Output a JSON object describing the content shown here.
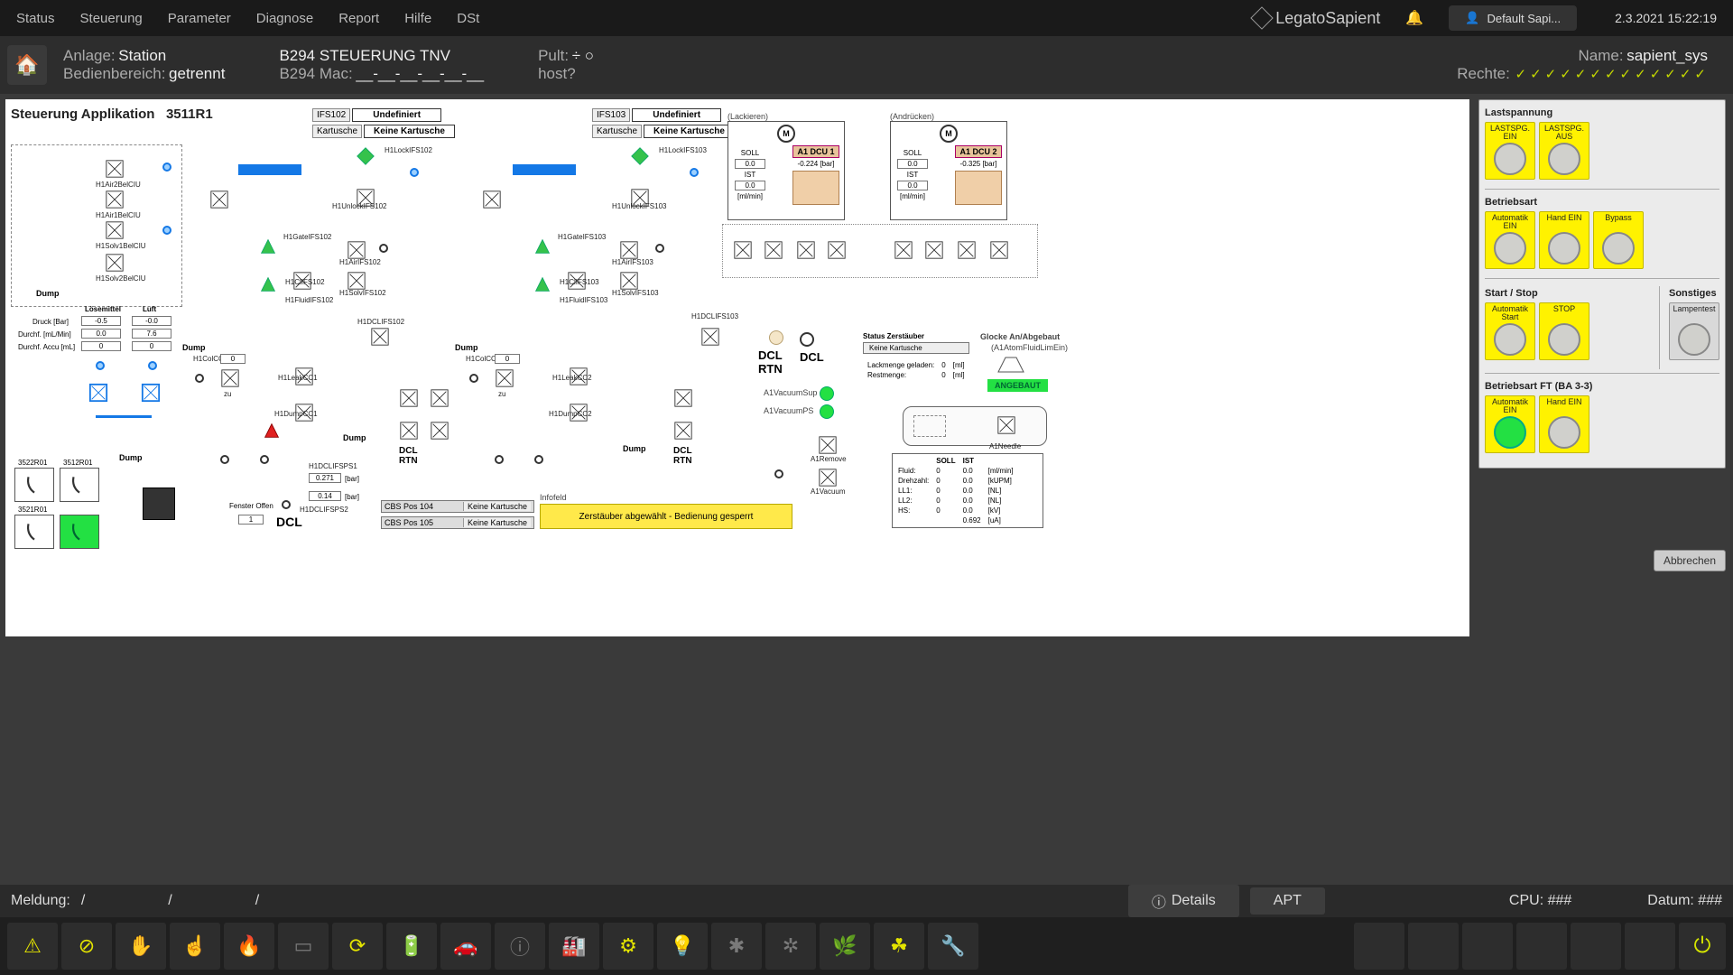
{
  "menu": {
    "status": "Status",
    "steuerung": "Steuerung",
    "parameter": "Parameter",
    "diagnose": "Diagnose",
    "report": "Report",
    "hilfe": "Hilfe",
    "dst": "DSt"
  },
  "logo": {
    "brand": "Legato",
    "sub": "Sapient"
  },
  "user": "Default Sapi...",
  "datetime": "2.3.2021  15:22:19",
  "header": {
    "anlage_lbl": "Anlage:",
    "anlage": "Station",
    "bedien_lbl": "Bedienbereich:",
    "bedien": "getrennt",
    "b294steuer_lbl": "B294 STEUERUNG TNV",
    "b294mac_lbl": "B294 Mac:",
    "b294mac": "__-__-__-__-__-__",
    "pult_lbl": "Pult:",
    "pult": "÷  ○",
    "host_lbl": "host?",
    "name_lbl": "Name:",
    "name": "sapient_sys",
    "rechte_lbl": "Rechte:"
  },
  "canvas": {
    "title": "Steuerung Applikation",
    "id": "3511R1",
    "ifs102": {
      "tag": "IFS102",
      "state": "Undefiniert",
      "kart_lbl": "Kartusche",
      "kart": "Keine Kartusche"
    },
    "ifs103": {
      "tag": "IFS103",
      "state": "Undefiniert",
      "kart_lbl": "Kartusche",
      "kart": "Keine Kartusche"
    },
    "lackieren": "(Lackieren)",
    "andruecken": "(Andrücken)",
    "dcu1": {
      "title": "A1 DCU 1",
      "soll": "SOLL",
      "soll_v": "0.0",
      "ist": "IST",
      "ist_v": "0.0",
      "unit": "[ml/min]",
      "press": "-0.224",
      "press_u": "[bar]"
    },
    "dcu2": {
      "title": "A1 DCU 2",
      "soll": "SOLL",
      "soll_v": "0.0",
      "ist": "IST",
      "ist_v": "0.0",
      "unit": "[ml/min]",
      "press": "-0.325",
      "press_u": "[bar]"
    },
    "status_zerst": {
      "title": "Status Zerstäuber",
      "val": "Keine Kartusche",
      "lack_lbl": "Lackmenge geladen:",
      "lack": "0",
      "lack_u": "[ml]",
      "rest_lbl": "Restmenge:",
      "rest": "0",
      "rest_u": "[ml]"
    },
    "glocke": {
      "title": "Glocke An/Abgebaut",
      "sub": "(A1AtomFluidLimEin)",
      "state": "ANGEBAUT"
    },
    "vac1": "A1VacuumSup",
    "vac2": "A1VacuumPS",
    "dcl_rtn": "DCL\nRTN",
    "dcl": "DCL",
    "infofeld_title": "Infofeld",
    "infofeld": "Zerstäuber abgewählt - Bedienung gesperrt",
    "fenster_lbl": "Fenster Offen",
    "fenster_v": "1",
    "dcl_txt": "DCL",
    "ifsps": {
      "tag": "H1DCLIFSPS1",
      "v": "0.271",
      "u": "[bar]",
      "tag2": "H1DCLIFSPS2",
      "v2": "0.14",
      "u2": "[bar]"
    },
    "loes_col": "Lösemittel",
    "luft_col": "Luft",
    "druck_lbl": "Druck [Bar]",
    "durchf_lbl": "Durchf. [mL/Min]",
    "accu_lbl": "Durchf. Accu [mL]",
    "loes": {
      "druck": "-0.5",
      "flow": "0.0",
      "accu": "0"
    },
    "luft": {
      "druck": "-0.0",
      "flow": "7.6",
      "accu": "0"
    },
    "thumbs": {
      "a": "3522R01",
      "b": "3512R01",
      "c": "3521R01"
    },
    "cbs": {
      "p104": "CBS Pos 104",
      "p105": "CBS Pos 105",
      "val": "Keine Kartusche"
    },
    "col2": {
      "h1col": "H1ColCC1",
      "h1col_v": "0",
      "zu": "zu"
    },
    "col3": {
      "h1col": "H1ColCC2",
      "h1col_v": "0",
      "zu": "zu"
    },
    "valve_labels": {
      "h1lock102": "H1LockIFS102",
      "h1unlock102": "H1UnlockIFS102",
      "h1lock103": "H1LockIFS103",
      "h1unlock103": "H1UnlockIFS103",
      "h1gate102": "H1GateIFS102",
      "h1gate103": "H1GateIFS103",
      "h1air102": "H1AirIFS102",
      "h1solv102": "H1SolvIFS102",
      "h1cl102": "H1ClIFS102",
      "h1fluid102": "H1FluidIFS102",
      "h1air103": "H1AirIFS103",
      "h1solv103": "H1SolvIFS103",
      "h1cl103": "H1ClIFS103",
      "h1fluid103": "H1FluidIFS103",
      "h1dclifs102": "H1DCLIFS102",
      "h1dclifs103": "H1DCLIFS103",
      "h1leak1": "H1LeakCC1",
      "h1dump1": "H1DumpCC1",
      "h1leak2": "H1LeakCC2",
      "h1dump2": "H1DumpCC2",
      "h1air2": "H1Air2BelCIU",
      "h1air1": "H1Air1BelCIU",
      "h1solv1": "H1Solv1BelCIU",
      "h1solv2": "H1Solv2BelCIU",
      "a1remove": "A1Remove",
      "a1vacuum": "A1Vacuum",
      "a1needle": "A1Needle",
      "dump": "Dump"
    },
    "istable": {
      "soll": "SOLL",
      "ist": "IST",
      "rows": [
        {
          "n": "Fluid:",
          "s": "0",
          "i": "0.0",
          "u": "[ml/min]"
        },
        {
          "n": "Drehzahl:",
          "s": "0",
          "i": "0.0",
          "u": "[kUPM]"
        },
        {
          "n": "LL1:",
          "s": "0",
          "i": "0.0",
          "u": "[NL]"
        },
        {
          "n": "LL2:",
          "s": "0",
          "i": "0.0",
          "u": "[NL]"
        },
        {
          "n": "HS:",
          "s": "0",
          "i": "0.0",
          "u": "[kV]"
        },
        {
          "n": "",
          "s": "",
          "i": "0.692",
          "u": "[uA]"
        }
      ]
    }
  },
  "side": {
    "last_title": "Lastspannung",
    "last_ein": "LASTSPG. EIN",
    "last_aus": "LASTSPG. AUS",
    "betr_title": "Betriebsart",
    "auto_ein": "Automatik EIN",
    "hand_ein": "Hand EIN",
    "bypass": "Bypass",
    "ss_title": "Start / Stop",
    "sonst_title": "Sonstiges",
    "auto_start": "Automatik Start",
    "stop": "STOP",
    "lampentest": "Lampentest",
    "ft_title": "Betriebsart FT (BA 3-3)",
    "abbrechen": "Abbrechen"
  },
  "meld": {
    "lbl": "Meldung:",
    "slash": "/",
    "details": "Details",
    "apt": "APT",
    "cpu": "CPU: ###",
    "datum": "Datum: ###"
  },
  "tools": {
    "warn": "⚠",
    "stop": "⊘",
    "hand": "✋",
    "finger": "☝",
    "fire": "🔥",
    "chip": "▭",
    "cycle": "⟳",
    "battery": "🔋",
    "car": "🚗",
    "info": "ⓘ",
    "factory": "🏭",
    "gears": "⚙",
    "light": "💡",
    "fan": "✱",
    "fan2": "✲",
    "plant": "🌿",
    "leaf": "☘",
    "wrench": "🔧",
    "power": "⏻"
  }
}
